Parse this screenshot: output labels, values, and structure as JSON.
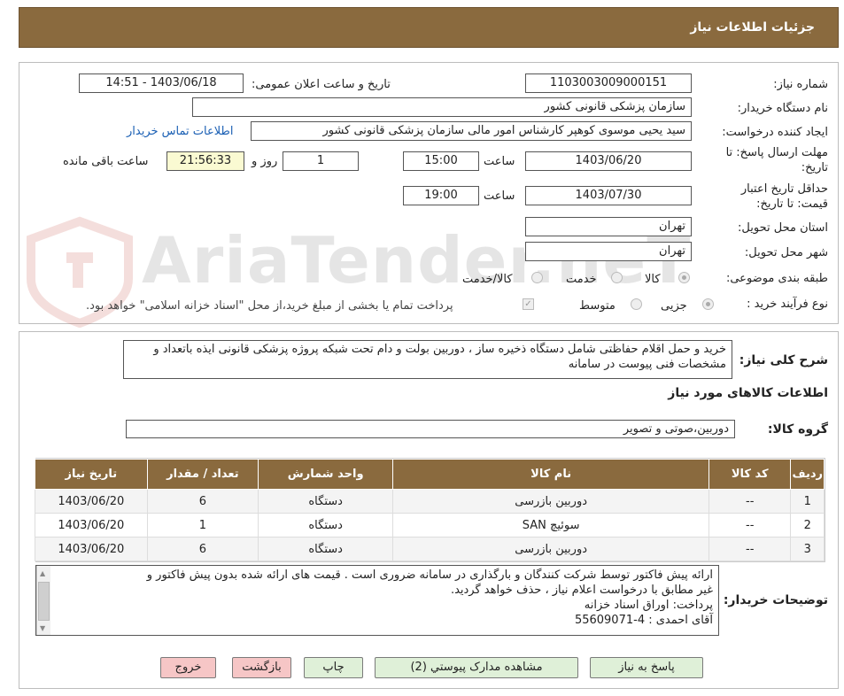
{
  "header": {
    "title": "جزئیات اطلاعات نیاز"
  },
  "watermark": {
    "text": "AriaTender.neT"
  },
  "form": {
    "need_number": {
      "label": "شماره نیاز:",
      "value": "1103003009000151"
    },
    "announce": {
      "label": "تاریخ و ساعت اعلان عمومی:",
      "value": "1403/06/18 - 14:51"
    },
    "buyer_org": {
      "label": "نام دستگاه خریدار:",
      "value": "سازمان پزشکی قانونی کشور"
    },
    "requester": {
      "label": "ایجاد کننده درخواست:",
      "value": "سید یحیی موسوی کوهپر کارشناس امور مالی سازمان پزشکی قانونی کشور",
      "contact_link": "اطلاعات تماس خریدار"
    },
    "deadline": {
      "label_line1": "مهلت ارسال پاسخ: تا",
      "label_line2": "تاریخ:",
      "date": "1403/06/20",
      "time_label": "ساعت",
      "time": "15:00",
      "days": "1",
      "days_label": "روز و",
      "remaining": "21:56:33",
      "remaining_label": "ساعت باقی مانده"
    },
    "validity": {
      "label_line1": "حداقل تاریخ اعتبار",
      "label_line2": "قیمت: تا تاریخ:",
      "date": "1403/07/30",
      "time_label": "ساعت",
      "time": "19:00"
    },
    "province": {
      "label": "استان محل تحویل:",
      "value": "تهران"
    },
    "city": {
      "label": "شهر محل تحویل:",
      "value": "تهران"
    },
    "category": {
      "label": "طبقه بندی موضوعی:",
      "options": [
        "کالا",
        "خدمت",
        "کالا/خدمت"
      ],
      "selected": "کالا"
    },
    "purchase_type": {
      "label": "نوع فرآیند خرید :",
      "options": [
        "جزیی",
        "متوسط"
      ],
      "selected": "جزیی",
      "note": "پرداخت تمام یا بخشی از مبلغ خرید،از محل \"اسناد خزانه اسلامی\" خواهد بود."
    }
  },
  "summary": {
    "label": "شرح کلی نیاز:",
    "text": "خرید و حمل اقلام حفاظتی  شامل دستگاه ذخیره ساز ، دوربین بولت و  دام تحت شبکه  پروژه پزشکی قانونی ایذه باتعداد و  مشخصات فنی پیوست در سامانه"
  },
  "goods_section": {
    "title": "اطلاعات کالاهای مورد نیاز",
    "group_label": "گروه کالا:",
    "group_value": "دوربین،صوتی و تصویر"
  },
  "table": {
    "headers": [
      "ردیف",
      "کد کالا",
      "نام کالا",
      "واحد شمارش",
      "تعداد / مقدار",
      "تاریخ نیاز"
    ],
    "rows": [
      [
        "1",
        "--",
        "دوربین بازرسی",
        "دستگاه",
        "6",
        "1403/06/20"
      ],
      [
        "2",
        "--",
        "سوئیچ SAN",
        "دستگاه",
        "1",
        "1403/06/20"
      ],
      [
        "3",
        "--",
        "دوربین بازرسی",
        "دستگاه",
        "6",
        "1403/06/20"
      ]
    ]
  },
  "buyer_notes": {
    "label": "توضیحات خریدار:",
    "lines": [
      "ارائه پیش فاکتور  توسط شرکت کنندگان و بارگذاری در سامانه ضروری است . قیمت های ارائه شده بدون پیش فاکتور  و",
      "غیر مطابق با درخواست اعلام نیاز  ،  حذف خواهد گردید.",
      "پرداخت: اوراق اسناد خزانه",
      "آقای احمدی :   4-55609071"
    ]
  },
  "buttons": {
    "reply": "پاسخ به نیاز",
    "attachments": "مشاهده مدارک پیوستي (2)",
    "print": "چاپ",
    "back": "بازگشت",
    "exit": "خروج"
  },
  "colors": {
    "header_bg": "#8a6a3e",
    "green_button": "#dff0d8",
    "pink_button": "#f6c6c6",
    "link": "#1a5fb4"
  }
}
